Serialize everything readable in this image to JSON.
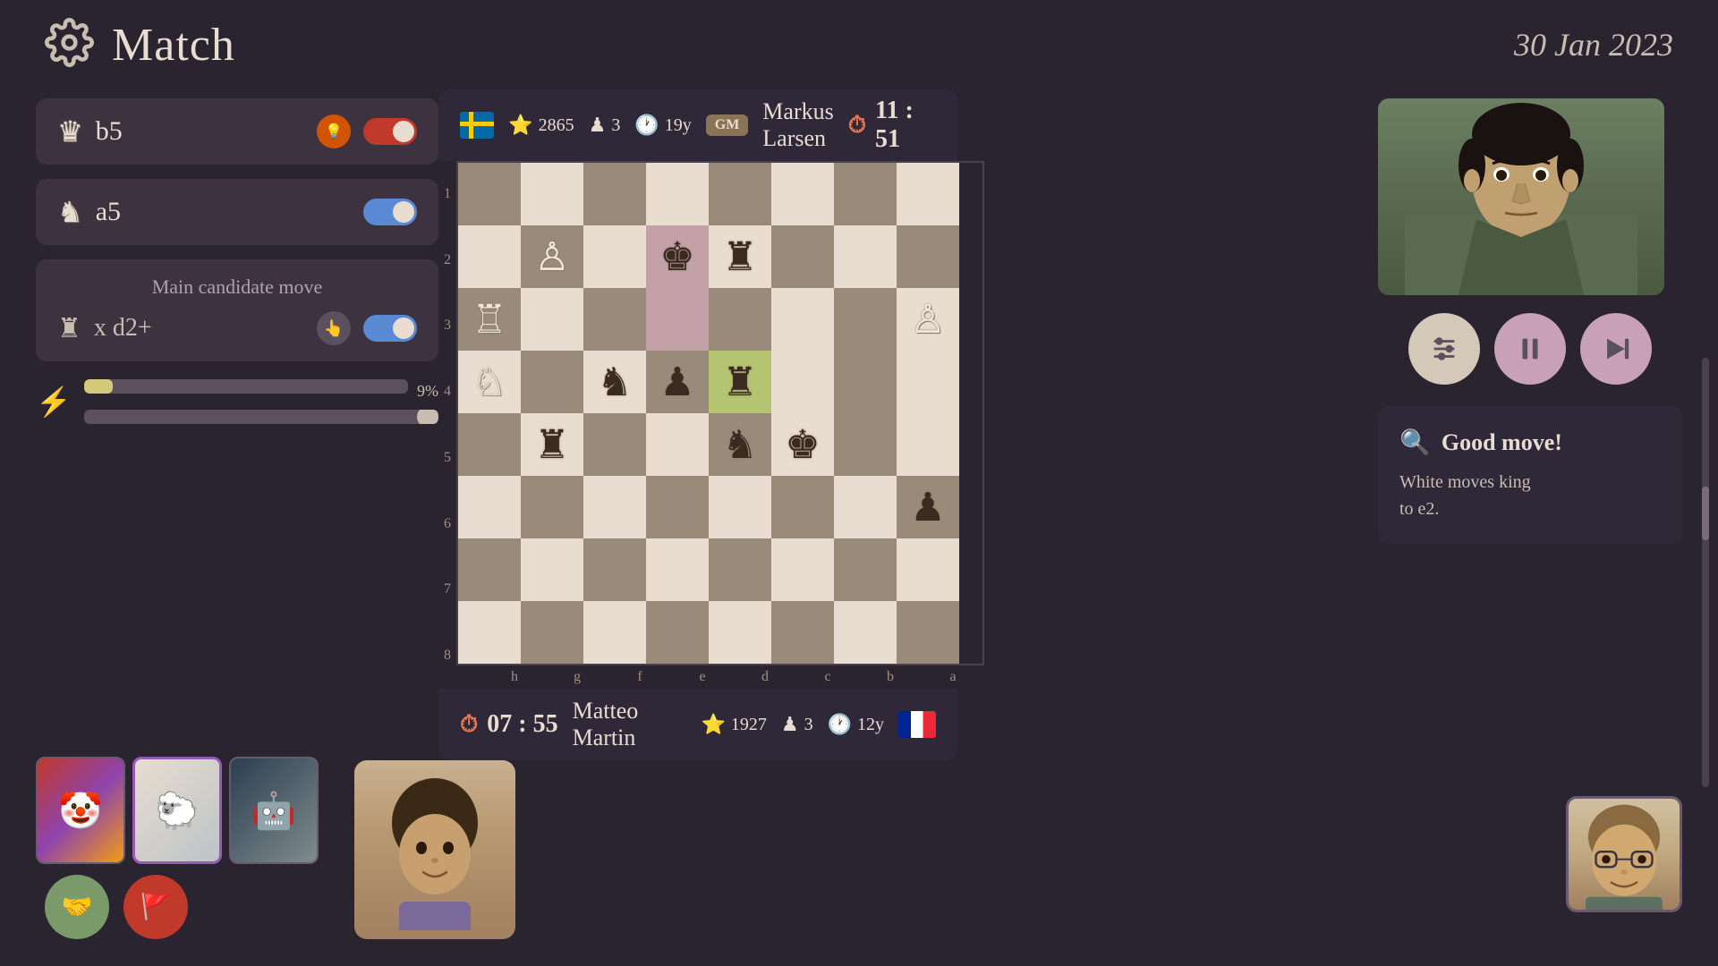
{
  "header": {
    "title": "Match",
    "date": "30 Jan 2023",
    "gear_icon": "⚙"
  },
  "player_top": {
    "flag": "SE",
    "rating": "2865",
    "games": "3",
    "age": "19y",
    "title": "GM",
    "name": "Markus Larsen",
    "time": "11 : 51"
  },
  "player_bottom": {
    "name": "Matteo Martin",
    "rating": "1927",
    "games": "3",
    "age": "12y",
    "flag": "FR",
    "time": "07 : 55"
  },
  "moves": {
    "move1": {
      "piece": "♛",
      "text": "b5",
      "has_hint": true
    },
    "move2": {
      "piece": "♞",
      "text": "a5"
    },
    "candidate_label": "Main candidate move",
    "candidate_move": "x d2+"
  },
  "progress": {
    "percent": "9%",
    "percent_value": 9
  },
  "analysis": {
    "label": "Good move!",
    "description": "White moves king\nto e2."
  },
  "controls": {
    "settings_icon": "⚙",
    "pause_icon": "⏸",
    "skip_icon": "⏭"
  },
  "board": {
    "rank_labels": [
      "1",
      "2",
      "3",
      "4",
      "5",
      "6",
      "7",
      "8"
    ],
    "file_labels": [
      "h",
      "g",
      "f",
      "e",
      "d",
      "c",
      "b",
      "a"
    ]
  },
  "action_buttons": {
    "handshake": "🤝",
    "flag": "🚩"
  }
}
